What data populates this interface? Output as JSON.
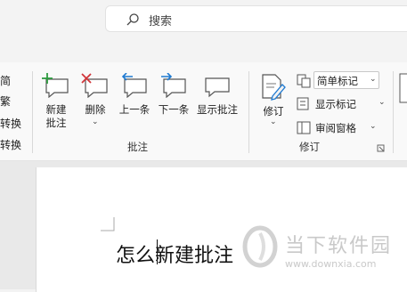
{
  "search": {
    "placeholder": "搜索"
  },
  "left_partial": [
    "简",
    "繁",
    "转换",
    "转换"
  ],
  "comments_group": {
    "label": "批注",
    "buttons": [
      {
        "label": "新建\n批注",
        "icon": "new-comment-icon"
      },
      {
        "label": "删除",
        "icon": "delete-comment-icon"
      },
      {
        "label": "上一条",
        "icon": "previous-comment-icon"
      },
      {
        "label": "下一条",
        "icon": "next-comment-icon"
      },
      {
        "label": "显示批注",
        "icon": "show-comments-icon"
      }
    ]
  },
  "tracking_group": {
    "label": "修订",
    "track_button": "修订",
    "markup_select": "简单标记",
    "show_markup": "显示标记",
    "reviewing_pane": "审阅窗格"
  },
  "document": {
    "text": "怎么新建批注"
  },
  "watermark": {
    "name": "当下软件园",
    "url": "www.downxia.com"
  },
  "colors": {
    "accent_green": "#2e9b3f",
    "accent_red": "#d13438",
    "accent_blue": "#1f7ad1"
  }
}
